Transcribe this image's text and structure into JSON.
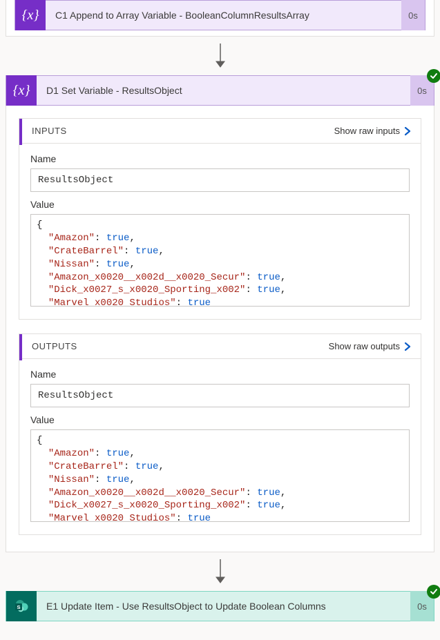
{
  "action_c1": {
    "title": "C1 Append to Array Variable - BooleanColumnResultsArray",
    "duration": "0s"
  },
  "action_d1": {
    "title": "D1 Set Variable - ResultsObject",
    "duration": "0s",
    "inputs": {
      "section_label": "INPUTS",
      "show_raw_label": "Show raw inputs",
      "name_label": "Name",
      "name_value": "ResultsObject",
      "value_label": "Value",
      "json_props": [
        {
          "key": "Amazon",
          "val": "true"
        },
        {
          "key": "CrateBarrel",
          "val": "true"
        },
        {
          "key": "Nissan",
          "val": "true"
        },
        {
          "key": "Amazon_x0020__x002d__x0020_Secur",
          "val": "true"
        },
        {
          "key": "Dick_x0027_s_x0020_Sporting_x002",
          "val": "true"
        },
        {
          "key": "Marvel_x0020_Studios",
          "val": "true"
        }
      ]
    },
    "outputs": {
      "section_label": "OUTPUTS",
      "show_raw_label": "Show raw outputs",
      "name_label": "Name",
      "name_value": "ResultsObject",
      "value_label": "Value",
      "json_props": [
        {
          "key": "Amazon",
          "val": "true"
        },
        {
          "key": "CrateBarrel",
          "val": "true"
        },
        {
          "key": "Nissan",
          "val": "true"
        },
        {
          "key": "Amazon_x0020__x002d__x0020_Secur",
          "val": "true"
        },
        {
          "key": "Dick_x0027_s_x0020_Sporting_x002",
          "val": "true"
        },
        {
          "key": "Marvel_x0020_Studios",
          "val": "true"
        }
      ]
    }
  },
  "action_e1": {
    "title": "E1 Update Item - Use ResultsObject to Update Boolean Columns",
    "duration": "0s"
  }
}
